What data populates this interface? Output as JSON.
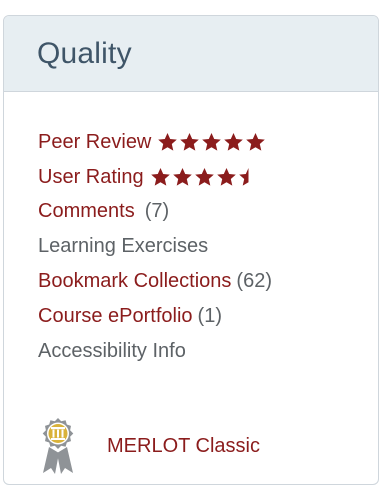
{
  "panel": {
    "title": "Quality"
  },
  "items": {
    "peer_review": {
      "label": "Peer Review",
      "rating": 5,
      "max": 5
    },
    "user_rating": {
      "label": "User Rating",
      "rating": 4.5,
      "max": 5
    },
    "comments": {
      "label": "Comments",
      "count": "(7)"
    },
    "learning_exercises": {
      "label": "Learning Exercises"
    },
    "bookmark_collections": {
      "label": "Bookmark Collections",
      "count": "(62)"
    },
    "course_eportfolio": {
      "label": "Course ePortfolio",
      "count": "(1)"
    },
    "accessibility_info": {
      "label": "Accessibility Info"
    }
  },
  "award": {
    "label": "MERLOT Classic",
    "icon": "award-ribbon-icon"
  },
  "colors": {
    "link": "#8b1c1c",
    "muted": "#5d6266",
    "header_bg": "#e7eef2",
    "title": "#3f5568",
    "border": "#cfd6dc",
    "badge_gold": "#d9b23a",
    "badge_gray": "#8f9397"
  }
}
